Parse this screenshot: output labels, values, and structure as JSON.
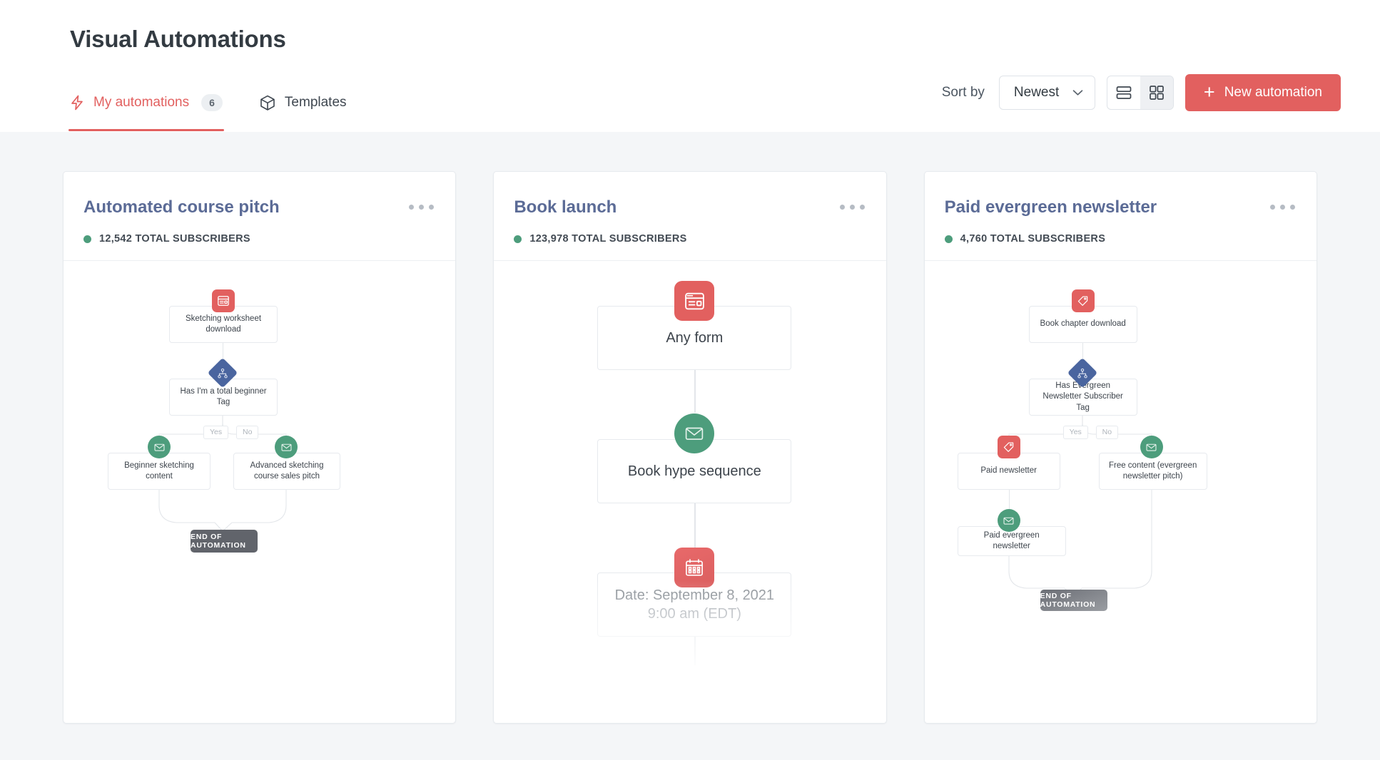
{
  "header": {
    "title": "Visual Automations",
    "tabs": [
      {
        "label": "My automations",
        "icon": "lightning-bolt-icon",
        "badge": "6",
        "active": true
      },
      {
        "label": "Templates",
        "icon": "cube-icon",
        "badge": "",
        "active": false
      }
    ]
  },
  "toolbar": {
    "sort_label": "Sort by",
    "sort_value": "Newest",
    "sort_icon": "chevron-down-icon",
    "view_list_icon": "list-view-icon",
    "view_grid_icon": "grid-view-icon",
    "active_view": "grid",
    "new_button_label": "New automation",
    "new_button_icon": "plus-icon"
  },
  "colors": {
    "accent_red": "#e2605f",
    "node_green": "#4d9d7c",
    "node_blue": "#4a659f",
    "card_title": "#5b6b96",
    "end_gray": "#61646b",
    "page_bg": "#f4f6f8"
  },
  "labels": {
    "end_of_automation": "END OF AUTOMATION",
    "yes": "Yes",
    "no": "No",
    "menu_icon": "ellipsis-icon",
    "status_dot": "status-dot-active"
  },
  "cards": [
    {
      "title": "Automated course pitch",
      "subscribers": "12,542 TOTAL SUBSCRIBERS",
      "nodes": {
        "trigger": "Sketching worksheet download",
        "condition": "Has I'm a total beginner Tag",
        "yes_branch": "Beginner sketching content",
        "no_branch": "Advanced sketching course sales pitch"
      },
      "icons": {
        "trigger": "form-icon",
        "condition": "branch-icon",
        "yes_branch": "email-icon",
        "no_branch": "email-icon"
      }
    },
    {
      "title": "Book launch",
      "subscribers": "123,978 TOTAL SUBSCRIBERS",
      "nodes": {
        "trigger": "Any form",
        "sequence": "Book hype sequence",
        "date_line1": "Date: September 8, 2021",
        "date_line2": "9:00 am (EDT)"
      },
      "icons": {
        "trigger": "form-icon",
        "sequence": "email-icon",
        "date": "calendar-icon"
      }
    },
    {
      "title": "Paid evergreen newsletter",
      "subscribers": "4,760 TOTAL SUBSCRIBERS",
      "nodes": {
        "trigger": "Book chapter download",
        "condition": "Has Evergreen Newsletter Subscriber Tag",
        "yes_branch": "Paid newsletter",
        "yes_branch_child": "Paid evergreen newsletter",
        "no_branch": "Free content (evergreen newsletter pitch)"
      },
      "icons": {
        "trigger": "tag-icon",
        "condition": "branch-icon",
        "yes_branch": "tag-icon",
        "yes_branch_child": "email-icon",
        "no_branch": "email-icon"
      }
    }
  ]
}
